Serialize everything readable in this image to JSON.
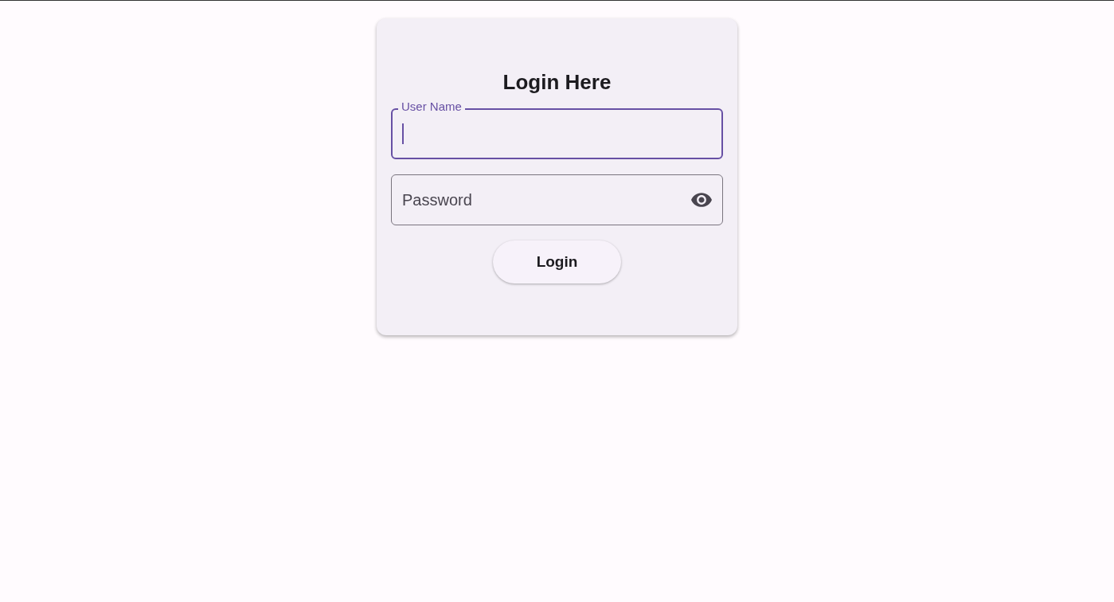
{
  "title": "Login Here",
  "fields": [
    {
      "kind": "text",
      "label": "User Name",
      "focused": true
    },
    {
      "kind": "password",
      "label": "Password",
      "focused": false
    }
  ],
  "button": "Login"
}
